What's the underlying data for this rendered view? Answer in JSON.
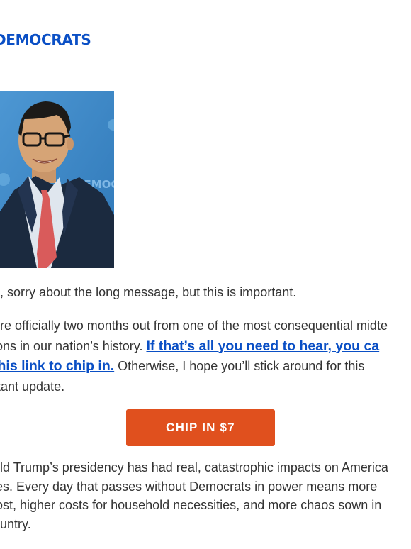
{
  "brand": {
    "name": "DEMOCRATS",
    "color": "#0a4fc5"
  },
  "photo": {
    "backdrop_text": "DEMOC",
    "backdrop_color": "#3b88c9"
  },
  "email": {
    "intro": "n, sorry about the long message, but this is important.",
    "p2": {
      "line1": "are officially two months out from one of the most consequential midte",
      "line2_text": "ions in our nation’s history. ",
      "line2_link": "If that’s all you need to hear, you ca",
      "line3_link": "this link to chip in.",
      "line3_text": " Otherwise, I hope you’ll stick around for this",
      "line4": "rtant update."
    },
    "cta_label": "CHIP IN $7",
    "cta_color": "#e0501e",
    "p3": {
      "line1": "ald Trump’s presidency has had real, catastrophic impacts on America",
      "line2": "ies. Every day that passes without Democrats in power means more",
      "line3": "lost, higher costs for household necessities, and more chaos sown in",
      "line4": "ountry."
    }
  }
}
